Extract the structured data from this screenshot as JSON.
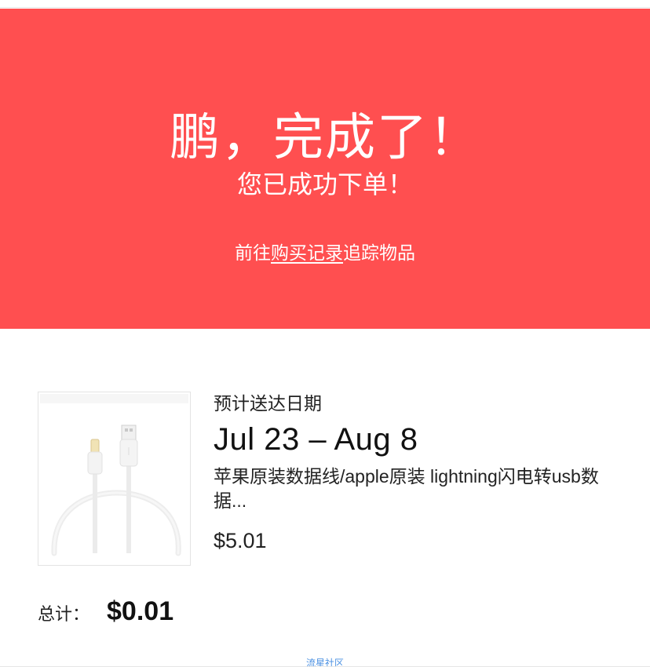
{
  "banner": {
    "headline": "鹏，完成了！",
    "subline": "您已成功下单！",
    "link_prefix": "前往",
    "link_text": "购买记录",
    "link_suffix": "追踪物品",
    "color": "#ff4f50"
  },
  "order": {
    "eta_label": "预计送达日期",
    "eta_date": "Jul 23 – Aug 8",
    "product_title": "苹果原装数据线/apple原装 lightning闪电转usb数据...",
    "price": "$5.01",
    "image_icon": "lightning-cable-image"
  },
  "total": {
    "label": "总计：",
    "value": "$0.01"
  },
  "watermark": "流星社区"
}
